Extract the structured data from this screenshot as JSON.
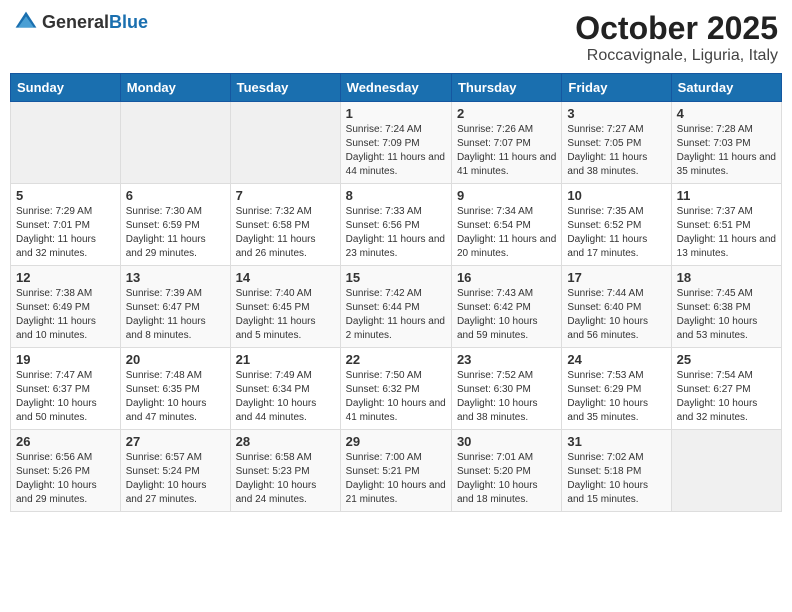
{
  "logo": {
    "general": "General",
    "blue": "Blue"
  },
  "header": {
    "month": "October 2025",
    "location": "Roccavignale, Liguria, Italy"
  },
  "weekdays": [
    "Sunday",
    "Monday",
    "Tuesday",
    "Wednesday",
    "Thursday",
    "Friday",
    "Saturday"
  ],
  "weeks": [
    [
      {
        "day": "",
        "sunrise": "",
        "sunset": "",
        "daylight": "",
        "empty": true
      },
      {
        "day": "",
        "sunrise": "",
        "sunset": "",
        "daylight": "",
        "empty": true
      },
      {
        "day": "",
        "sunrise": "",
        "sunset": "",
        "daylight": "",
        "empty": true
      },
      {
        "day": "1",
        "sunrise": "Sunrise: 7:24 AM",
        "sunset": "Sunset: 7:09 PM",
        "daylight": "Daylight: 11 hours and 44 minutes."
      },
      {
        "day": "2",
        "sunrise": "Sunrise: 7:26 AM",
        "sunset": "Sunset: 7:07 PM",
        "daylight": "Daylight: 11 hours and 41 minutes."
      },
      {
        "day": "3",
        "sunrise": "Sunrise: 7:27 AM",
        "sunset": "Sunset: 7:05 PM",
        "daylight": "Daylight: 11 hours and 38 minutes."
      },
      {
        "day": "4",
        "sunrise": "Sunrise: 7:28 AM",
        "sunset": "Sunset: 7:03 PM",
        "daylight": "Daylight: 11 hours and 35 minutes."
      }
    ],
    [
      {
        "day": "5",
        "sunrise": "Sunrise: 7:29 AM",
        "sunset": "Sunset: 7:01 PM",
        "daylight": "Daylight: 11 hours and 32 minutes."
      },
      {
        "day": "6",
        "sunrise": "Sunrise: 7:30 AM",
        "sunset": "Sunset: 6:59 PM",
        "daylight": "Daylight: 11 hours and 29 minutes."
      },
      {
        "day": "7",
        "sunrise": "Sunrise: 7:32 AM",
        "sunset": "Sunset: 6:58 PM",
        "daylight": "Daylight: 11 hours and 26 minutes."
      },
      {
        "day": "8",
        "sunrise": "Sunrise: 7:33 AM",
        "sunset": "Sunset: 6:56 PM",
        "daylight": "Daylight: 11 hours and 23 minutes."
      },
      {
        "day": "9",
        "sunrise": "Sunrise: 7:34 AM",
        "sunset": "Sunset: 6:54 PM",
        "daylight": "Daylight: 11 hours and 20 minutes."
      },
      {
        "day": "10",
        "sunrise": "Sunrise: 7:35 AM",
        "sunset": "Sunset: 6:52 PM",
        "daylight": "Daylight: 11 hours and 17 minutes."
      },
      {
        "day": "11",
        "sunrise": "Sunrise: 7:37 AM",
        "sunset": "Sunset: 6:51 PM",
        "daylight": "Daylight: 11 hours and 13 minutes."
      }
    ],
    [
      {
        "day": "12",
        "sunrise": "Sunrise: 7:38 AM",
        "sunset": "Sunset: 6:49 PM",
        "daylight": "Daylight: 11 hours and 10 minutes."
      },
      {
        "day": "13",
        "sunrise": "Sunrise: 7:39 AM",
        "sunset": "Sunset: 6:47 PM",
        "daylight": "Daylight: 11 hours and 8 minutes."
      },
      {
        "day": "14",
        "sunrise": "Sunrise: 7:40 AM",
        "sunset": "Sunset: 6:45 PM",
        "daylight": "Daylight: 11 hours and 5 minutes."
      },
      {
        "day": "15",
        "sunrise": "Sunrise: 7:42 AM",
        "sunset": "Sunset: 6:44 PM",
        "daylight": "Daylight: 11 hours and 2 minutes."
      },
      {
        "day": "16",
        "sunrise": "Sunrise: 7:43 AM",
        "sunset": "Sunset: 6:42 PM",
        "daylight": "Daylight: 10 hours and 59 minutes."
      },
      {
        "day": "17",
        "sunrise": "Sunrise: 7:44 AM",
        "sunset": "Sunset: 6:40 PM",
        "daylight": "Daylight: 10 hours and 56 minutes."
      },
      {
        "day": "18",
        "sunrise": "Sunrise: 7:45 AM",
        "sunset": "Sunset: 6:38 PM",
        "daylight": "Daylight: 10 hours and 53 minutes."
      }
    ],
    [
      {
        "day": "19",
        "sunrise": "Sunrise: 7:47 AM",
        "sunset": "Sunset: 6:37 PM",
        "daylight": "Daylight: 10 hours and 50 minutes."
      },
      {
        "day": "20",
        "sunrise": "Sunrise: 7:48 AM",
        "sunset": "Sunset: 6:35 PM",
        "daylight": "Daylight: 10 hours and 47 minutes."
      },
      {
        "day": "21",
        "sunrise": "Sunrise: 7:49 AM",
        "sunset": "Sunset: 6:34 PM",
        "daylight": "Daylight: 10 hours and 44 minutes."
      },
      {
        "day": "22",
        "sunrise": "Sunrise: 7:50 AM",
        "sunset": "Sunset: 6:32 PM",
        "daylight": "Daylight: 10 hours and 41 minutes."
      },
      {
        "day": "23",
        "sunrise": "Sunrise: 7:52 AM",
        "sunset": "Sunset: 6:30 PM",
        "daylight": "Daylight: 10 hours and 38 minutes."
      },
      {
        "day": "24",
        "sunrise": "Sunrise: 7:53 AM",
        "sunset": "Sunset: 6:29 PM",
        "daylight": "Daylight: 10 hours and 35 minutes."
      },
      {
        "day": "25",
        "sunrise": "Sunrise: 7:54 AM",
        "sunset": "Sunset: 6:27 PM",
        "daylight": "Daylight: 10 hours and 32 minutes."
      }
    ],
    [
      {
        "day": "26",
        "sunrise": "Sunrise: 6:56 AM",
        "sunset": "Sunset: 5:26 PM",
        "daylight": "Daylight: 10 hours and 29 minutes."
      },
      {
        "day": "27",
        "sunrise": "Sunrise: 6:57 AM",
        "sunset": "Sunset: 5:24 PM",
        "daylight": "Daylight: 10 hours and 27 minutes."
      },
      {
        "day": "28",
        "sunrise": "Sunrise: 6:58 AM",
        "sunset": "Sunset: 5:23 PM",
        "daylight": "Daylight: 10 hours and 24 minutes."
      },
      {
        "day": "29",
        "sunrise": "Sunrise: 7:00 AM",
        "sunset": "Sunset: 5:21 PM",
        "daylight": "Daylight: 10 hours and 21 minutes."
      },
      {
        "day": "30",
        "sunrise": "Sunrise: 7:01 AM",
        "sunset": "Sunset: 5:20 PM",
        "daylight": "Daylight: 10 hours and 18 minutes."
      },
      {
        "day": "31",
        "sunrise": "Sunrise: 7:02 AM",
        "sunset": "Sunset: 5:18 PM",
        "daylight": "Daylight: 10 hours and 15 minutes."
      },
      {
        "day": "",
        "sunrise": "",
        "sunset": "",
        "daylight": "",
        "empty": true
      }
    ]
  ]
}
